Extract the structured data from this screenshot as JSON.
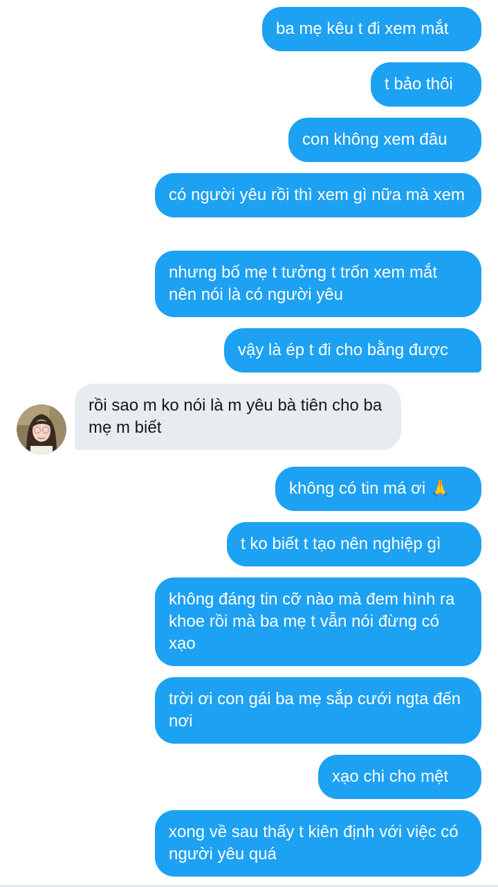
{
  "messages": [
    {
      "from": "me",
      "text": "ba mẹ kêu t đi xem mắt"
    },
    {
      "from": "me",
      "text": "t bảo thôi"
    },
    {
      "from": "me",
      "text": "con không xem đâu"
    },
    {
      "from": "me",
      "text": "có người yêu rồi thì xem gì nữa mà xem"
    },
    {
      "from": "me",
      "text": "nhưng bố mẹ t tưởng t trốn xem mắt nên nói là có người yêu"
    },
    {
      "from": "me",
      "text": "vậy là ép t đi cho bằng được"
    },
    {
      "from": "them",
      "text": "rồi sao m ko nói là m yêu bà tiên cho ba mẹ m biết"
    },
    {
      "from": "me",
      "text": "không có tin má ơi 🙏"
    },
    {
      "from": "me",
      "text": "t ko biết t tạo nên nghiệp gì"
    },
    {
      "from": "me",
      "text": "không đáng tin cỡ nào mà đem hình ra khoe rồi mà ba mẹ t vẫn nói đừng có xạo"
    },
    {
      "from": "me",
      "text": "trời ơi con gái ba mẹ sắp cưới ngta đến nơi"
    },
    {
      "from": "me",
      "text": "xạo chi cho mệt"
    },
    {
      "from": "me",
      "text": "xong về sau thấy t kiên định với việc có người yêu quá"
    }
  ],
  "colors": {
    "sent_bubble": "#1da1f2",
    "received_bubble": "#e6ecf0",
    "sent_text": "#ffffff",
    "received_text": "#14171a"
  }
}
